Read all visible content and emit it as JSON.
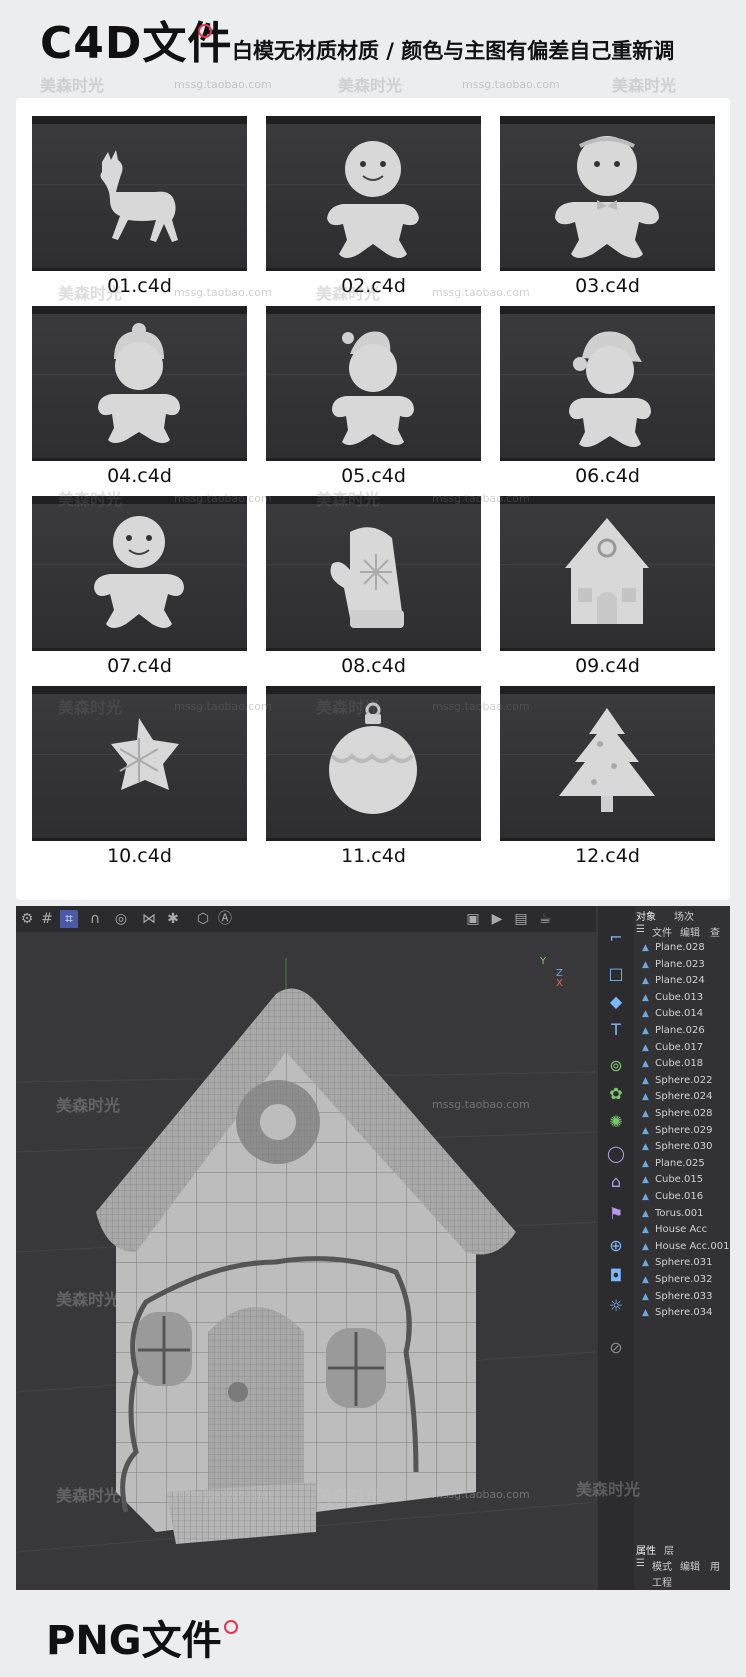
{
  "header": {
    "c4d_title": "C4D文件",
    "subtitle": "白模无材质材质 / 颜色与主图有偏差自己重新调"
  },
  "watermark": {
    "brand": "美森时光",
    "url": "mssg.taobao.com"
  },
  "files": [
    {
      "name": "01.c4d",
      "icon": "deer-model"
    },
    {
      "name": "02.c4d",
      "icon": "gingerbread-man-model"
    },
    {
      "name": "03.c4d",
      "icon": "gingerbread-man-bow-model"
    },
    {
      "name": "04.c4d",
      "icon": "gingerbread-beanie-model"
    },
    {
      "name": "05.c4d",
      "icon": "gingerbread-santa-hat-model"
    },
    {
      "name": "06.c4d",
      "icon": "gingerbread-santa-hat-tilted-model"
    },
    {
      "name": "07.c4d",
      "icon": "gingerbread-man-plain-model"
    },
    {
      "name": "08.c4d",
      "icon": "mitten-model"
    },
    {
      "name": "09.c4d",
      "icon": "gingerbread-house-model"
    },
    {
      "name": "10.c4d",
      "icon": "snowflake-star-model"
    },
    {
      "name": "11.c4d",
      "icon": "ornament-ball-model"
    },
    {
      "name": "12.c4d",
      "icon": "christmas-tree-model"
    }
  ],
  "viewport": {
    "tabs": {
      "objects": "对象",
      "takes": "场次"
    },
    "menu": {
      "file": "文件",
      "edit": "编辑",
      "view": "查"
    },
    "objects": [
      "Plane.028",
      "Plane.023",
      "Plane.024",
      "Cube.013",
      "Cube.014",
      "Plane.026",
      "Cube.017",
      "Cube.018",
      "Sphere.022",
      "Sphere.024",
      "Sphere.028",
      "Sphere.029",
      "Sphere.030",
      "Plane.025",
      "Cube.015",
      "Cube.016",
      "Torus.001",
      "House Acc",
      "House Acc.001",
      "Sphere.031",
      "Sphere.032",
      "Sphere.033",
      "Sphere.034"
    ],
    "attr_tabs": {
      "attributes": "属性",
      "layers": "层"
    },
    "attr_menu": {
      "mode": "模式",
      "edit": "编辑",
      "user": "用"
    },
    "project": "工程",
    "axis": {
      "y": "Y",
      "z": "Z",
      "x": "X"
    }
  },
  "png_title": "PNG文件",
  "colors": {
    "accent_dot": "#e8344f",
    "viewport_bg": "#38383a",
    "c4d_blue": "#6fa8dc"
  }
}
